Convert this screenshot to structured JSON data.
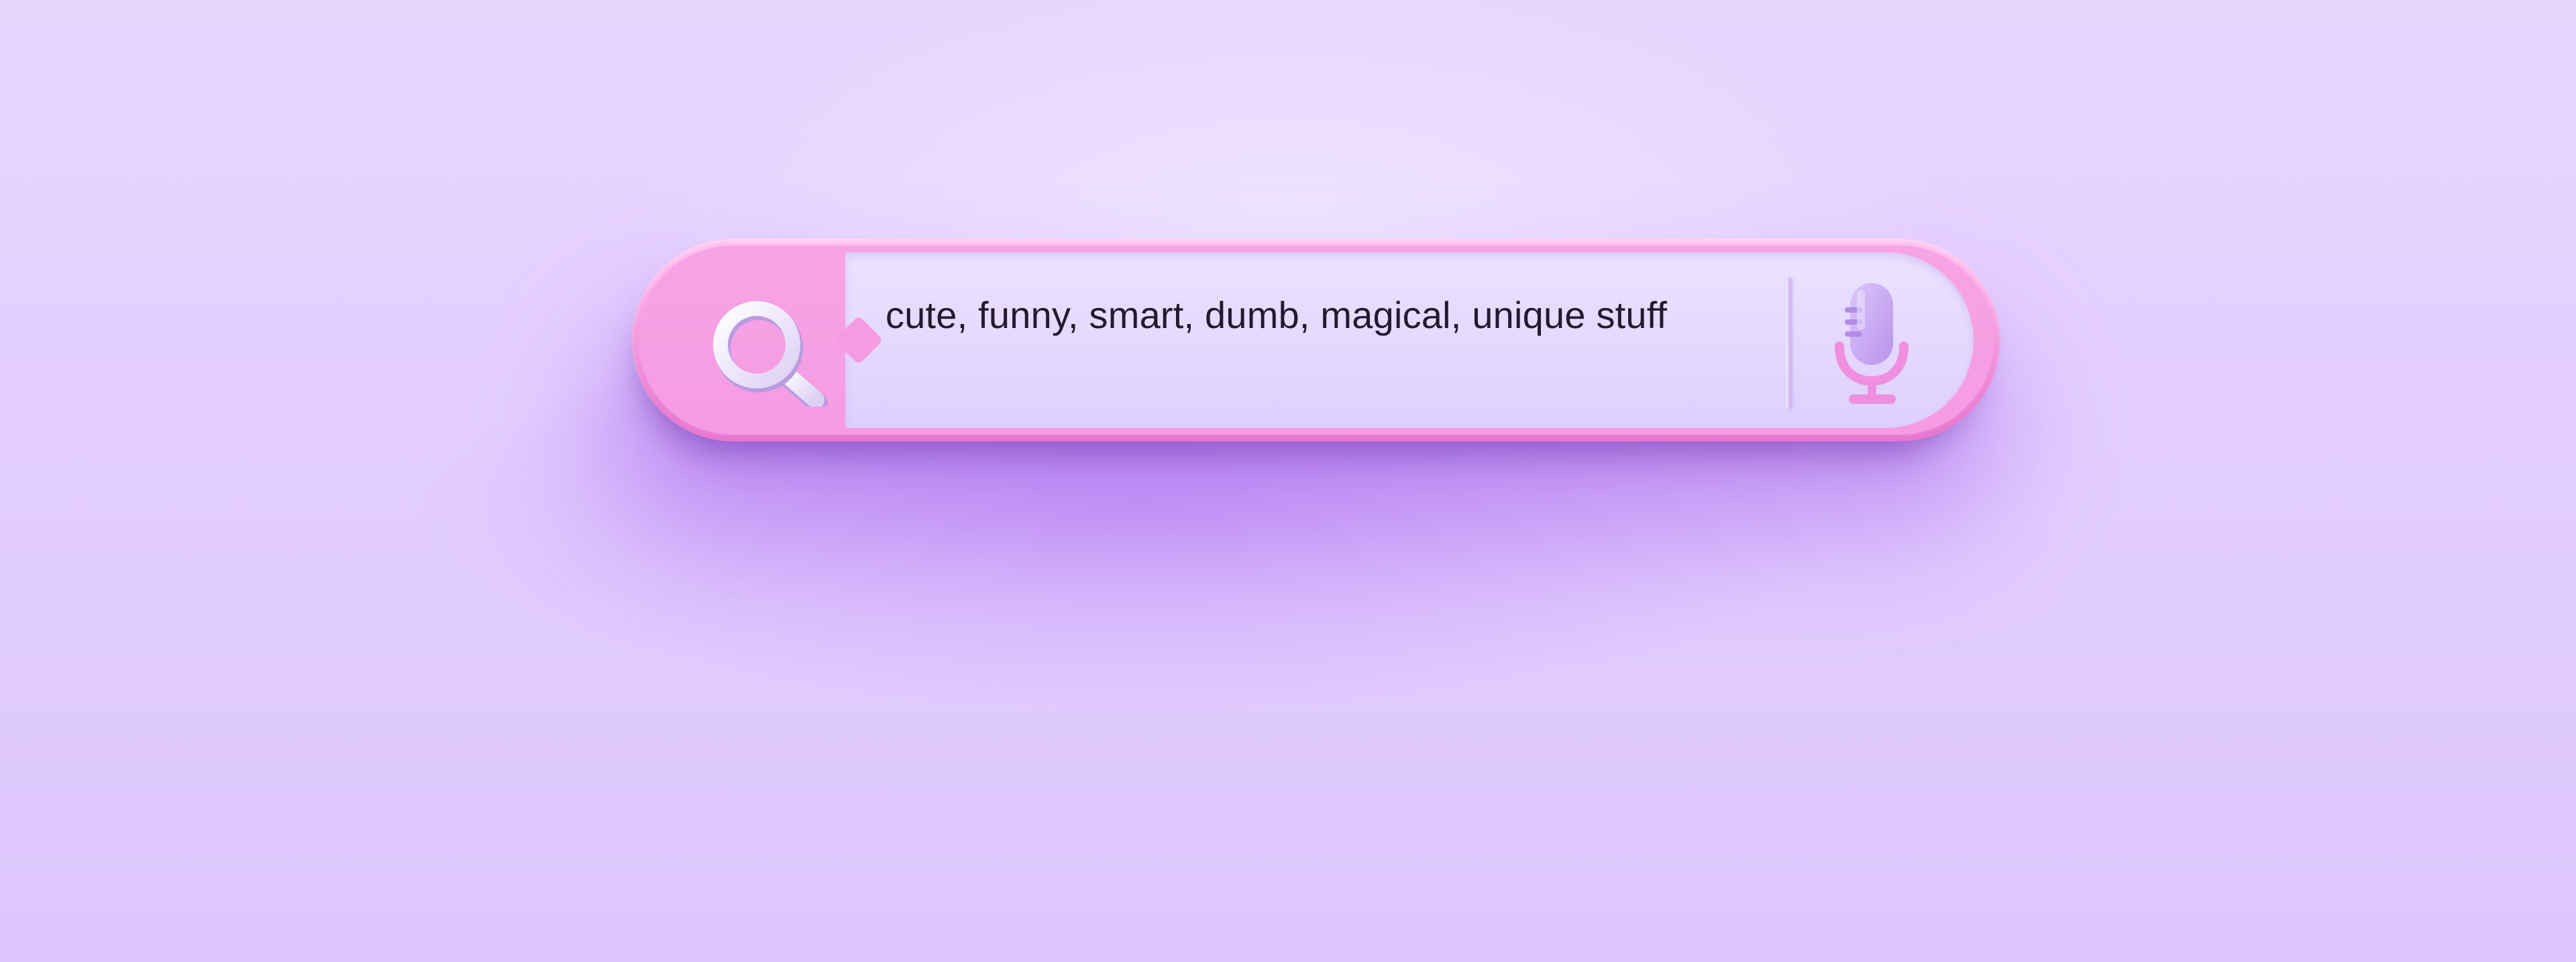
{
  "search": {
    "query": "cute, funny, smart, dumb, magical, unique stuff"
  },
  "icons": {
    "search": "magnifying-glass",
    "voice": "microphone"
  },
  "colors": {
    "background": "#e4d0ff",
    "bar_rim": "#f79ae3",
    "field": "#e7ddff",
    "text": "#241a2e",
    "search_icon": "#efe6ff",
    "mic_icon": "#c9a8f2",
    "mic_stand": "#f18fdf"
  }
}
